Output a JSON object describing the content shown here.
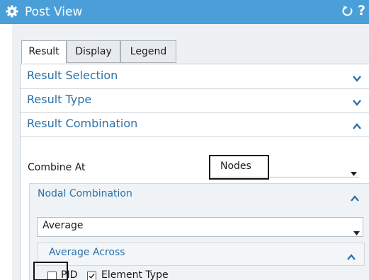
{
  "window": {
    "title": "Post View",
    "help_label": "?"
  },
  "tabs": [
    {
      "label": "Result",
      "active": true
    },
    {
      "label": "Display",
      "active": false
    },
    {
      "label": "Legend",
      "active": false
    }
  ],
  "sections": {
    "result_selection": {
      "label": "Result Selection",
      "expanded": false
    },
    "result_type": {
      "label": "Result Type",
      "expanded": false
    },
    "result_combination": {
      "label": "Result Combination",
      "expanded": true
    }
  },
  "combine_at": {
    "label": "Combine At",
    "value": "Nodes"
  },
  "nodal_combination": {
    "label": "Nodal Combination",
    "method": "Average",
    "average_across": {
      "label": "Average Across",
      "pid": {
        "label": "PID",
        "checked": false
      },
      "element_type": {
        "label": "Element Type",
        "checked": true
      }
    }
  },
  "colors": {
    "accent": "#4a9fd8",
    "section_text": "#2a6fa8"
  }
}
